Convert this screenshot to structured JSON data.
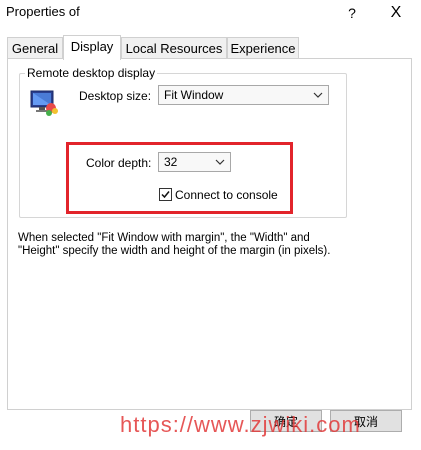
{
  "window": {
    "title": "Properties of",
    "help_label": "?",
    "close_label": "X"
  },
  "tabs": [
    {
      "label": "General"
    },
    {
      "label": "Display"
    },
    {
      "label": "Local Resources"
    },
    {
      "label": "Experience"
    }
  ],
  "group": {
    "label": "Remote desktop display",
    "desktop_size_label": "Desktop size:",
    "desktop_size_value": "Fit Window",
    "color_depth_label": "Color depth:",
    "color_depth_value": "32",
    "connect_console_label": "Connect to console",
    "connect_console_checked": true
  },
  "note": {
    "text": "When selected \"Fit Window with margin\", the \"Width\" and \"Height\" specify the width and height of the margin (in pixels)."
  },
  "buttons": {
    "ok_label": "确定",
    "cancel_label": "取消"
  },
  "watermark": {
    "text": "https://www.zjwiki.com"
  },
  "colors": {
    "highlight": "#e2242b",
    "watermark": "#e23a3a"
  }
}
